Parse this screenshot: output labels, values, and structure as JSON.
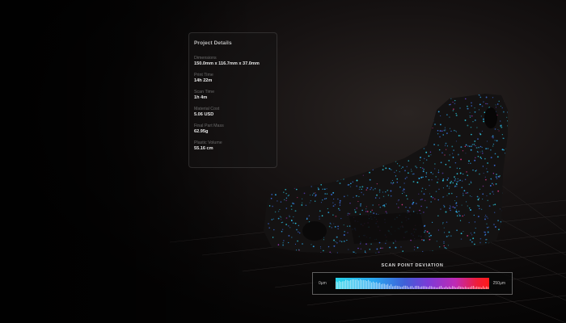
{
  "panel": {
    "title": "Project Details",
    "details": [
      {
        "label": "Dimensions",
        "value": "150.0mm x 116.7mm x 37.0mm"
      },
      {
        "label": "Print Time",
        "value": "14h 22m"
      },
      {
        "label": "Scan Time",
        "value": "1h 4m"
      },
      {
        "label": "Material Cost",
        "value": "5.06 USD"
      },
      {
        "label": "Final Part Mass",
        "value": "62.95g"
      },
      {
        "label": "Plastic Volume",
        "value": "55.16 cm"
      }
    ]
  },
  "legend": {
    "title": "SCAN POINT DEVIATION",
    "min_label": "0µm",
    "max_label": "250µm"
  },
  "colors": {
    "low": "#27d4ea",
    "mid": "#7b3bd8",
    "high": "#ff1a1a"
  }
}
